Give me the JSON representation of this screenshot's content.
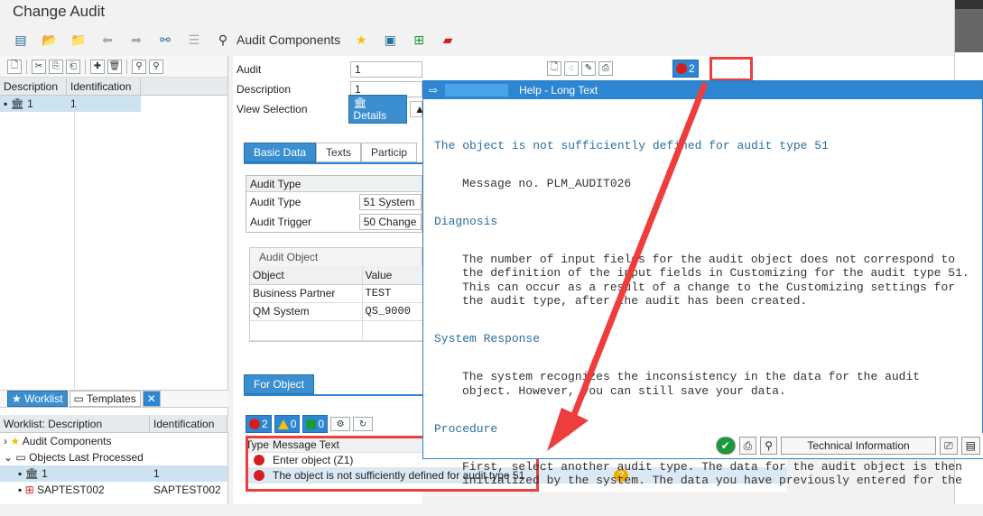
{
  "window": {
    "title": "Change Audit"
  },
  "toolbar": {
    "audit_components_label": "Audit Components"
  },
  "left_pane": {
    "columns": [
      "Description",
      "Identification"
    ],
    "rows": [
      {
        "description": "1",
        "identification": "1"
      }
    ],
    "tabs": [
      "Worklist",
      "Templates"
    ],
    "worklist_columns": [
      "Worklist: Description",
      "Identification"
    ],
    "worklist_rows": [
      {
        "description": "Audit Components",
        "identification": ""
      },
      {
        "description": "Objects Last Processed",
        "identification": ""
      },
      {
        "description": "1",
        "identification": "1"
      },
      {
        "description": "SAPTEST002",
        "identification": "SAPTEST002"
      }
    ]
  },
  "header_fields": {
    "audit_label": "Audit",
    "audit_value": "1",
    "description_label": "Description",
    "description_value": "1",
    "view_selection_label": "View Selection",
    "view_selection_value": "Details"
  },
  "tabs": {
    "basic_data": "Basic Data",
    "texts": "Texts",
    "partic": "Particip"
  },
  "audit_type_box": {
    "header": "Audit Type",
    "type_label": "Audit Type",
    "type_value": "51 System",
    "trigger_label": "Audit Trigger",
    "trigger_value": "50 Change"
  },
  "audit_object": {
    "header": "Audit Object",
    "columns": [
      "Object",
      "Value"
    ],
    "rows": [
      {
        "object": "Business Partner",
        "value": "TEST"
      },
      {
        "object": "QM System",
        "value": "QS_9000"
      }
    ]
  },
  "for_object_tab": "For Object",
  "message_counts": {
    "errors": "2",
    "warnings": "0",
    "success": "0"
  },
  "top_error_count": "2",
  "messages": {
    "columns": [
      "Type",
      "Message Text"
    ],
    "rows": [
      {
        "text": "Enter object (Z1)"
      },
      {
        "text": "The object is not sufficiently defined for audit type 51"
      }
    ]
  },
  "help": {
    "title": "Help - Long Text",
    "heading": "The object is not sufficiently defined for audit type 51",
    "message_no": "Message no. PLM_AUDIT026",
    "diagnosis_h": "Diagnosis",
    "diagnosis": "The number of input fields for the audit object does not correspond to\nthe definition of the input fields in Customizing for the audit type 51.\nThis can occur as a result of a change to the Customizing settings for\nthe audit type, after the audit has been created.",
    "response_h": "System Response",
    "response": "The system recognizes the inconsistency in the data for the audit\nobject. However, you can still save your data.",
    "procedure_h": "Procedure",
    "procedure": "First, select another audit type. The data for the audit object is then\ninitialized by the system. The data you have previously entered for the",
    "tech_info_button": "Technical Information"
  },
  "colors": {
    "accent": "#2e86d2",
    "error": "#d51f1f",
    "annotation": "#ee3d3d"
  }
}
